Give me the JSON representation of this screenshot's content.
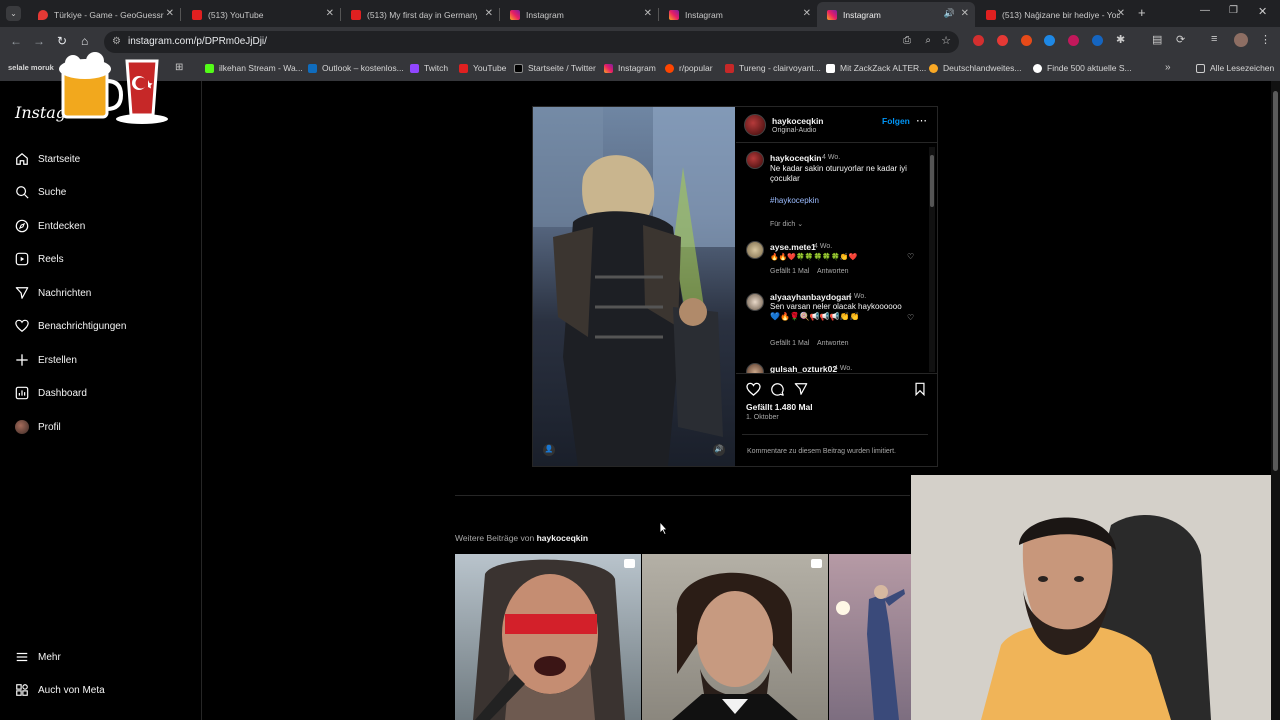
{
  "browser": {
    "tabs": [
      {
        "label": "Türkiye - Game - GeoGuessr",
        "icon": "geoguessr-icon"
      },
      {
        "label": "(513) YouTube",
        "icon": "youtube-icon"
      },
      {
        "label": "(513) My first day in Germany",
        "icon": "youtube-icon"
      },
      {
        "label": "Instagram",
        "icon": "instagram-icon"
      },
      {
        "label": "Instagram",
        "icon": "instagram-icon"
      },
      {
        "label": "Instagram",
        "icon": "instagram-icon",
        "active": true
      },
      {
        "label": "(513) Nağizane bir hediye - You",
        "icon": "youtube-icon"
      }
    ],
    "url": "instagram.com/p/DPRm0eJjDji/",
    "bookmarks": [
      "selale moruk",
      "ilkehan Stream - Wa...",
      "Outlook – kostenlos...",
      "Twitch",
      "YouTube",
      "Startseite / Twitter",
      "Instagram",
      "r/popular",
      "Tureng - clairvoyant...",
      "Mit ZackZack ALTER...",
      "Deutschlandweites...",
      "Finde 500 aktuelle S..."
    ],
    "all_bookmarks": "Alle Lesezeichen"
  },
  "sidebar": {
    "logo": "Instagram",
    "items": [
      {
        "label": "Startseite",
        "icon": "home-icon"
      },
      {
        "label": "Suche",
        "icon": "search-icon"
      },
      {
        "label": "Entdecken",
        "icon": "compass-icon"
      },
      {
        "label": "Reels",
        "icon": "reels-icon"
      },
      {
        "label": "Nachrichten",
        "icon": "send-icon"
      },
      {
        "label": "Benachrichtigungen",
        "icon": "heart-icon"
      },
      {
        "label": "Erstellen",
        "icon": "plus-icon"
      },
      {
        "label": "Dashboard",
        "icon": "chart-icon"
      },
      {
        "label": "Profil",
        "icon": "avatar-icon"
      }
    ],
    "more": "Mehr",
    "meta": "Auch von Meta"
  },
  "post": {
    "username": "haykoceqkin",
    "audio": "Original-Audio",
    "follow": "Folgen",
    "caption": {
      "user": "haykoceqkin",
      "time": "4 Wo.",
      "text": "Ne kadar sakin oturuyorlar ne kadar iyi çocuklar",
      "hashtag": "#haykocepkin",
      "translate": "Für dich"
    },
    "comments": [
      {
        "user": "ayse.mete1",
        "time": "4 Wo.",
        "text": "🔥🔥❤️🍀🍀🍀🍀🍀👏❤️",
        "likes": "Gefällt 1 Mal",
        "reply": "Antworten"
      },
      {
        "user": "alyaayhanbaydogan",
        "time": "4 Wo.",
        "text": "Sen varsan neler olacak haykoooooo💙🔥🌹🍭📢📢📢👏👏",
        "likes": "Gefällt 1 Mal",
        "reply": "Antworten"
      },
      {
        "user": "gulsah_ozturk02",
        "time": "4 Wo."
      }
    ],
    "likes": "Gefällt 1.480 Mal",
    "date": "1. Oktober",
    "comments_limited": "Kommentare zu diesem Beitrag wurden limitiert."
  },
  "more_posts": {
    "prefix": "Weitere Beiträge von",
    "user": "haykoceqkin"
  },
  "colors": {
    "accent": "#0095f6",
    "background": "#000000",
    "border": "#262626"
  }
}
